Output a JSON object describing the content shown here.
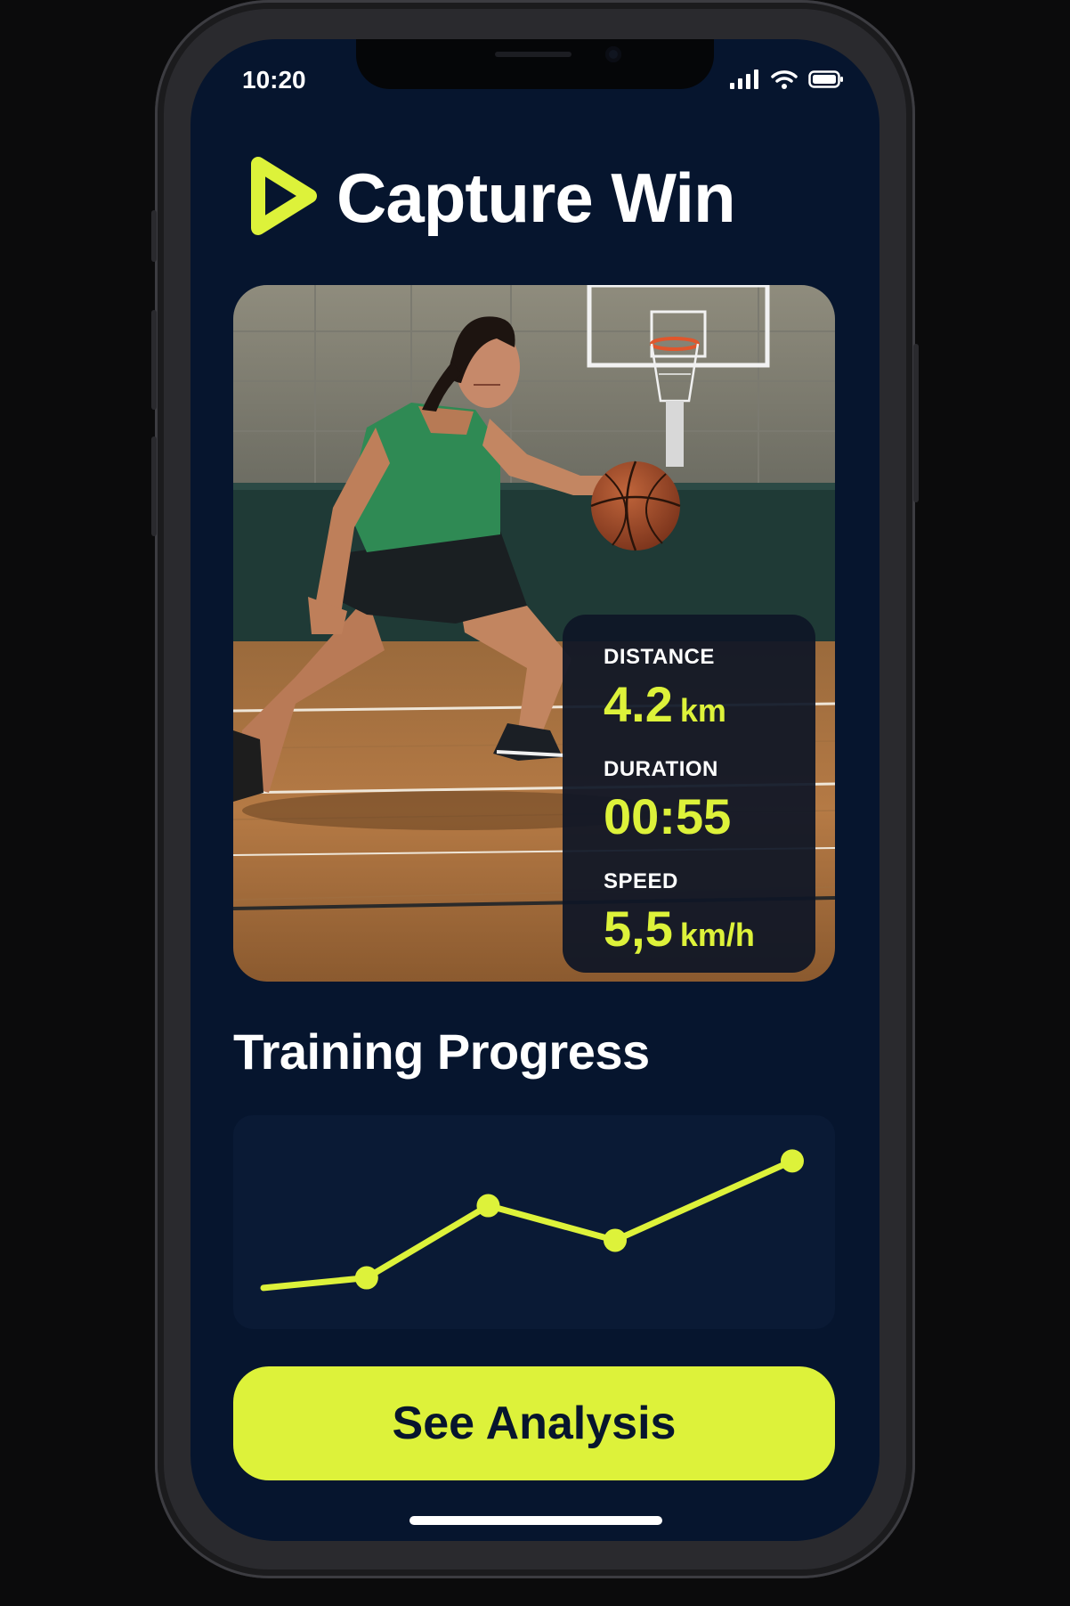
{
  "status_bar": {
    "time": "10:20",
    "icons": [
      "signal-icon",
      "wifi-icon",
      "battery-icon"
    ]
  },
  "header": {
    "logo_icon": "play-icon",
    "title": "Capture Win"
  },
  "colors": {
    "accent": "#DDF23A",
    "background": "#06152E",
    "card": "#0A1A35",
    "text": "#FFFFFF"
  },
  "hero": {
    "image_subject": "basketball player dribbling on indoor court",
    "stats": [
      {
        "label": "DISTANCE",
        "value": "4.2",
        "unit": "km"
      },
      {
        "label": "DURATION",
        "value": "00:55",
        "unit": ""
      },
      {
        "label": "SPEED",
        "value": "5,5",
        "unit": "km/h"
      }
    ]
  },
  "progress": {
    "title": "Training Progress"
  },
  "chart_data": {
    "type": "line",
    "x": [
      0,
      1,
      2,
      3,
      4,
      5
    ],
    "series": [
      {
        "values": [
          1.0,
          1.4,
          4.1,
          2.6,
          5.4,
          null
        ],
        "markers": [
          false,
          true,
          true,
          true,
          true
        ]
      }
    ],
    "points": [
      0.05,
      0.12,
      0.62,
      0.38,
      0.93
    ],
    "xlim": [
      0,
      4
    ],
    "ylim": [
      0,
      1
    ],
    "grid": false,
    "title": "",
    "xlabel": "",
    "ylabel": ""
  },
  "cta": {
    "label": "See Analysis"
  }
}
